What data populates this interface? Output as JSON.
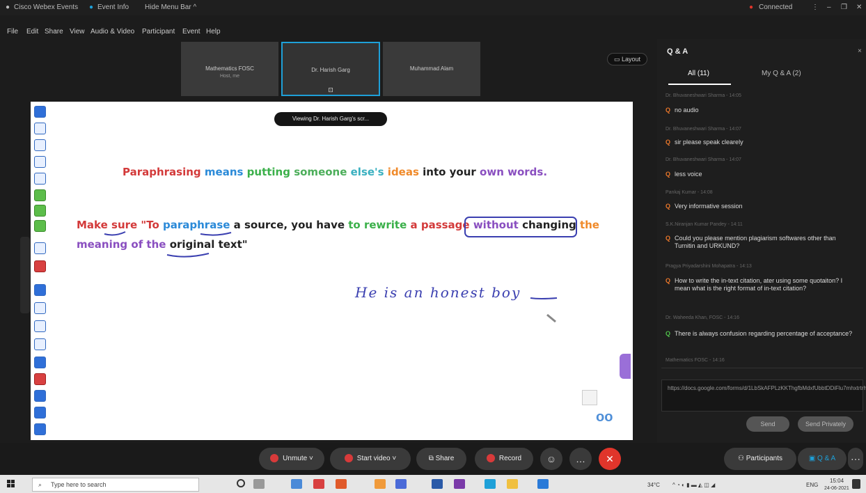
{
  "window": {
    "app_title": "Cisco Webex Events",
    "event_info": "Event Info",
    "hide_menu": "Hide Menu Bar ^",
    "connected": "Connected"
  },
  "menu": [
    "File",
    "Edit",
    "Share",
    "View",
    "Audio & Video",
    "Participant",
    "Event",
    "Help"
  ],
  "thumbnails": [
    {
      "name": "Mathematics FOSC",
      "sub": "Host, me"
    },
    {
      "name": "Dr. Harish Garg",
      "sub": ""
    },
    {
      "name": "Muhammad Alam",
      "sub": ""
    }
  ],
  "layout_label": "Layout",
  "viewing_label": "Viewing Dr. Harish Garg's scr...",
  "slide": {
    "para": [
      {
        "t": "Paraphrasing ",
        "c": "#d33a3a"
      },
      {
        "t": "means ",
        "c": "#2b8ad8"
      },
      {
        "t": "putting ",
        "c": "#3bb04a"
      },
      {
        "t": "someone ",
        "c": "#4cae5a"
      },
      {
        "t": "else's ",
        "c": "#3ab0c0"
      },
      {
        "t": "ideas ",
        "c": "#f08a2a"
      },
      {
        "t": "into your ",
        "c": "#222222"
      },
      {
        "t": "own words.",
        "c": "#8a4fc0"
      }
    ],
    "line1": [
      {
        "t": "Make sure ",
        "c": "#d33a3a"
      },
      {
        "t": "\"To ",
        "c": "#d33a3a"
      },
      {
        "t": "paraphrase ",
        "c": "#2b8ad8"
      },
      {
        "t": "a source, you have ",
        "c": "#222222"
      },
      {
        "t": "to rewrite ",
        "c": "#3bb04a"
      },
      {
        "t": "a passage ",
        "c": "#d33a3a"
      },
      {
        "t": "without ",
        "c": "#8a4fc0"
      },
      {
        "t": "changing ",
        "c": "#222222"
      },
      {
        "t": "the",
        "c": "#f08a2a"
      }
    ],
    "line2": [
      {
        "t": "meaning of the ",
        "c": "#8a4fc0"
      },
      {
        "t": "original text",
        "c": "#222222"
      },
      {
        "t": "\"",
        "c": "#222222"
      }
    ],
    "handwriting": "He is an honest boy"
  },
  "qa": {
    "title": "Q & A",
    "tab_all": "All (11)",
    "tab_my": "My Q & A (2)",
    "items": [
      {
        "author": "Dr. Bhuvaneshwari Sharma - 14:05",
        "q": "no audio"
      },
      {
        "author": "Dr. Bhuvaneshwari Sharma - 14:07",
        "q": "sir please speak clearely"
      },
      {
        "author": "Dr. Bhuvaneshwari Sharma - 14:07",
        "q": "less voice"
      },
      {
        "author": "Pankaj Kumar - 14:08",
        "q": "Very informative session"
      },
      {
        "author": "S.K.Niranjan Kumar Pandey - 14:11",
        "q": "Could you please mention plagiarism softwares other than Turnitin and URKUND?"
      },
      {
        "author": "Pragya Priyadarshini Mohapatra - 14:13",
        "q": "How to write the in-text citation, ater using some quotaiton? I mean what is the right format of in-text citation?"
      },
      {
        "author": "Dr. Waheeda Khan, FOSC - 14:16",
        "q": "There is always confusion regarding percentage of acceptance?"
      },
      {
        "author": "Mathematics FOSC - 14:16",
        "q": ""
      }
    ],
    "answer_text": "https://docs.google.com/forms/d/1LbSkAFPLzKKThgfbMdxfUbbtDDiFlu7mhxtrtrhREE",
    "send_label": "Send",
    "send_private_label": "Send Privately"
  },
  "controls": {
    "unmute": "Unmute",
    "start_video": "Start video",
    "share": "Share",
    "record": "Record",
    "participants": "Participants",
    "qa": "Q & A"
  },
  "taskbar": {
    "search_placeholder": "Type here to search",
    "weather": "34°C",
    "lang": "ENG",
    "time": "15:04",
    "date": "24-06-2021"
  }
}
